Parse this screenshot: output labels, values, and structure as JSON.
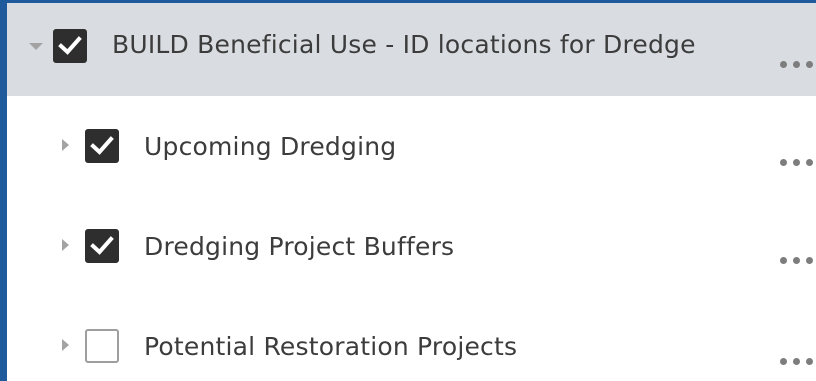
{
  "layer_list": {
    "group": {
      "label": "BUILD Beneficial Use - ID locations for Dredge",
      "checked": true,
      "expanded": true
    },
    "layers": [
      {
        "label": "Upcoming Dredging",
        "checked": true,
        "expanded": false
      },
      {
        "label": "Dredging Project Buffers",
        "checked": true,
        "expanded": false
      },
      {
        "label": "Potential Restoration Projects",
        "checked": false,
        "expanded": false
      }
    ]
  },
  "colors": {
    "panel_border": "#1e5a9c",
    "group_row_bg": "#d9dde1",
    "checkbox_checked": "#2e2e2e",
    "text": "#3c3c3c"
  }
}
